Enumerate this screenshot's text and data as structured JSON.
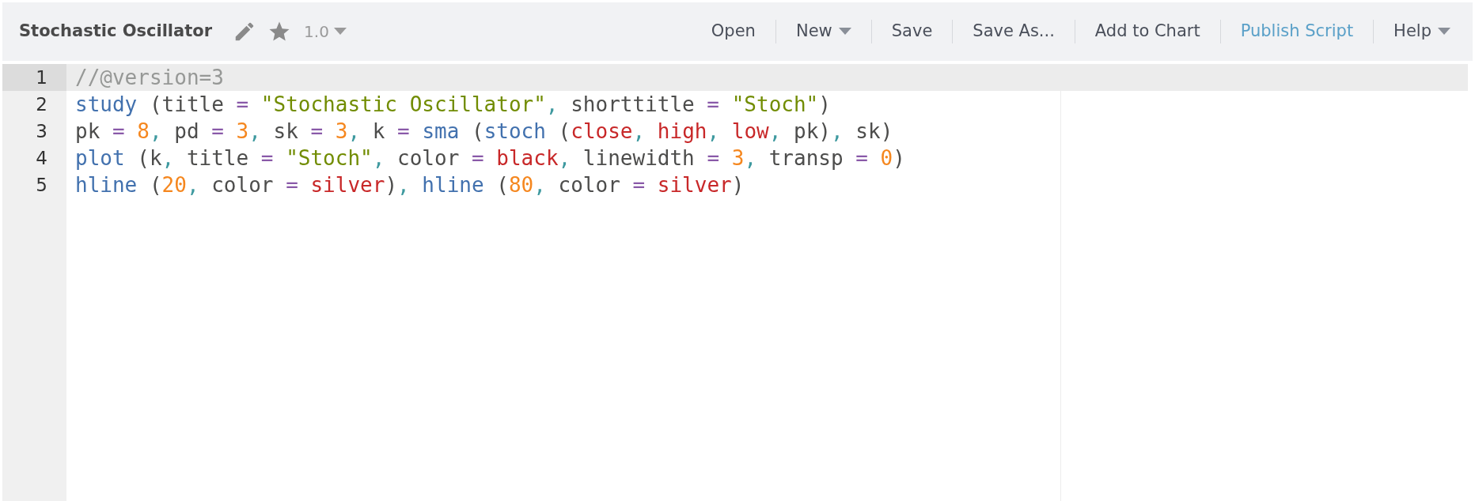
{
  "toolbar": {
    "title": "Stochastic Oscillator",
    "version": "1.0",
    "menu": [
      {
        "label": "Open",
        "kind": "plain"
      },
      {
        "label": "New",
        "kind": "dropdown"
      },
      {
        "label": "Save",
        "kind": "plain"
      },
      {
        "label": "Save As...",
        "kind": "plain"
      },
      {
        "label": "Add to Chart",
        "kind": "plain"
      },
      {
        "label": "Publish Script",
        "kind": "accent"
      },
      {
        "label": "Help",
        "kind": "dropdown"
      }
    ]
  },
  "editor": {
    "lines": [
      {
        "number": "1",
        "selected": true,
        "tokens": [
          {
            "kind": "comment",
            "text": "//@version=3"
          }
        ]
      },
      {
        "number": "2",
        "selected": false,
        "tokens": [
          {
            "kind": "function",
            "text": "study"
          },
          {
            "kind": "plain",
            "text": " (title "
          },
          {
            "kind": "operator",
            "text": "= "
          },
          {
            "kind": "string",
            "text": "\"Stochastic Oscillator\""
          },
          {
            "kind": "punct",
            "text": ", "
          },
          {
            "kind": "plain",
            "text": "shorttitle "
          },
          {
            "kind": "operator",
            "text": "= "
          },
          {
            "kind": "string",
            "text": "\"Stoch\""
          },
          {
            "kind": "plain",
            "text": ")"
          }
        ]
      },
      {
        "number": "3",
        "selected": false,
        "tokens": [
          {
            "kind": "plain",
            "text": "pk "
          },
          {
            "kind": "operator",
            "text": "= "
          },
          {
            "kind": "number",
            "text": "8"
          },
          {
            "kind": "punct",
            "text": ", "
          },
          {
            "kind": "plain",
            "text": "pd "
          },
          {
            "kind": "operator",
            "text": "= "
          },
          {
            "kind": "number",
            "text": "3"
          },
          {
            "kind": "punct",
            "text": ", "
          },
          {
            "kind": "plain",
            "text": "sk "
          },
          {
            "kind": "operator",
            "text": "= "
          },
          {
            "kind": "number",
            "text": "3"
          },
          {
            "kind": "punct",
            "text": ", "
          },
          {
            "kind": "plain",
            "text": "k "
          },
          {
            "kind": "operator",
            "text": "= "
          },
          {
            "kind": "function",
            "text": "sma"
          },
          {
            "kind": "plain",
            "text": " ("
          },
          {
            "kind": "function",
            "text": "stoch"
          },
          {
            "kind": "plain",
            "text": " ("
          },
          {
            "kind": "constant",
            "text": "close"
          },
          {
            "kind": "punct",
            "text": ", "
          },
          {
            "kind": "constant",
            "text": "high"
          },
          {
            "kind": "punct",
            "text": ", "
          },
          {
            "kind": "constant",
            "text": "low"
          },
          {
            "kind": "punct",
            "text": ", "
          },
          {
            "kind": "plain",
            "text": "pk)"
          },
          {
            "kind": "punct",
            "text": ", "
          },
          {
            "kind": "plain",
            "text": "sk)"
          }
        ]
      },
      {
        "number": "4",
        "selected": false,
        "tokens": [
          {
            "kind": "function",
            "text": "plot"
          },
          {
            "kind": "plain",
            "text": " (k"
          },
          {
            "kind": "punct",
            "text": ", "
          },
          {
            "kind": "plain",
            "text": "title "
          },
          {
            "kind": "operator",
            "text": "= "
          },
          {
            "kind": "string",
            "text": "\"Stoch\""
          },
          {
            "kind": "punct",
            "text": ", "
          },
          {
            "kind": "plain",
            "text": "color "
          },
          {
            "kind": "operator",
            "text": "= "
          },
          {
            "kind": "constant",
            "text": "black"
          },
          {
            "kind": "punct",
            "text": ", "
          },
          {
            "kind": "plain",
            "text": "linewidth "
          },
          {
            "kind": "operator",
            "text": "= "
          },
          {
            "kind": "number",
            "text": "3"
          },
          {
            "kind": "punct",
            "text": ", "
          },
          {
            "kind": "plain",
            "text": "transp "
          },
          {
            "kind": "operator",
            "text": "= "
          },
          {
            "kind": "number",
            "text": "0"
          },
          {
            "kind": "plain",
            "text": ")"
          }
        ]
      },
      {
        "number": "5",
        "selected": false,
        "tokens": [
          {
            "kind": "function",
            "text": "hline"
          },
          {
            "kind": "plain",
            "text": " ("
          },
          {
            "kind": "number",
            "text": "20"
          },
          {
            "kind": "punct",
            "text": ", "
          },
          {
            "kind": "plain",
            "text": "color "
          },
          {
            "kind": "operator",
            "text": "= "
          },
          {
            "kind": "constant",
            "text": "silver"
          },
          {
            "kind": "plain",
            "text": ")"
          },
          {
            "kind": "punct",
            "text": ", "
          },
          {
            "kind": "function",
            "text": "hline"
          },
          {
            "kind": "plain",
            "text": " ("
          },
          {
            "kind": "number",
            "text": "80"
          },
          {
            "kind": "punct",
            "text": ", "
          },
          {
            "kind": "plain",
            "text": "color "
          },
          {
            "kind": "operator",
            "text": "= "
          },
          {
            "kind": "constant",
            "text": "silver"
          },
          {
            "kind": "plain",
            "text": ")"
          }
        ]
      }
    ]
  }
}
